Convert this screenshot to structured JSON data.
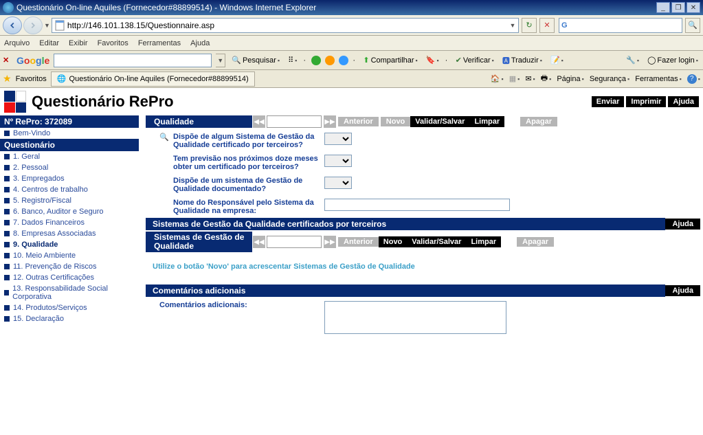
{
  "window": {
    "title": "Questionário On-line Aquiles (Fornecedor#88899514) - Windows Internet Explorer"
  },
  "address_bar": {
    "url": "http://146.101.138.15/Questionnaire.asp"
  },
  "search_box": {
    "engine": "Google",
    "value": ""
  },
  "menu": {
    "items": [
      "Arquivo",
      "Editar",
      "Exibir",
      "Favoritos",
      "Ferramentas",
      "Ajuda"
    ]
  },
  "google_toolbar": {
    "search": "Pesquisar",
    "share": "Compartilhar",
    "verify": "Verificar",
    "translate": "Traduzir",
    "login": "Fazer login"
  },
  "favorites_bar": {
    "label": "Favoritos",
    "tab_title": "Questionário On-line Aquiles (Fornecedor#88899514)"
  },
  "command_bar": {
    "page": "Página",
    "security": "Segurança",
    "tools": "Ferramentas"
  },
  "page": {
    "title": "Questionário RePro",
    "actions": {
      "send": "Enviar",
      "print": "Imprimir",
      "help": "Ajuda"
    }
  },
  "sidebar": {
    "repro_label": "Nº RePro: 372089",
    "welcome": "Bem-Vindo",
    "section_label": "Questionário",
    "items": [
      "1. Geral",
      "2. Pessoal",
      "3. Empregados",
      "4. Centros de trabalho",
      "5. Registro/Fiscal",
      "6. Banco, Auditor e Seguro",
      "7. Dados Financeiros",
      "8. Empresas Associadas",
      "9. Qualidade",
      "10. Meio Ambiente",
      "11. Prevenção de Riscos",
      "12. Outras Certificações",
      "13. Responsabilidade Social Corporativa",
      "14. Produtos/Serviços",
      "15. Declaração"
    ],
    "active_index": 8
  },
  "sections": {
    "qualidade": {
      "title": "Qualidade",
      "buttons": {
        "anterior": "Anterior",
        "novo": "Novo",
        "validar": "Validar/Salvar",
        "limpar": "Limpar",
        "apagar": "Apagar"
      },
      "questions": [
        {
          "text": "Dispõe de algum Sistema de Gestão da Qualidade certificado por terceiros?",
          "type": "select"
        },
        {
          "text": "Tem previsão nos próximos doze meses obter um certificado por terceiros?",
          "type": "select"
        },
        {
          "text": "Dispõe de um sistema de Gestão de Qualidade documentado?",
          "type": "select"
        },
        {
          "text": "Nome do Responsável pelo Sistema da Qualidade na empresa:",
          "type": "text"
        }
      ]
    },
    "certificados": {
      "title": "Sistemas de Gestão da Qualidade certificados por terceiros",
      "ajuda": "Ajuda"
    },
    "sgq": {
      "title": "Sistemas de Gestão de Qualidade",
      "buttons": {
        "anterior": "Anterior",
        "novo": "Novo",
        "validar": "Validar/Salvar",
        "limpar": "Limpar",
        "apagar": "Apagar"
      },
      "hint": "Utilize o botão 'Novo' para acrescentar Sistemas de Gestão de Qualidade"
    },
    "comentarios": {
      "title": "Comentários adicionais",
      "ajuda": "Ajuda",
      "label": "Comentários adicionais:"
    }
  }
}
